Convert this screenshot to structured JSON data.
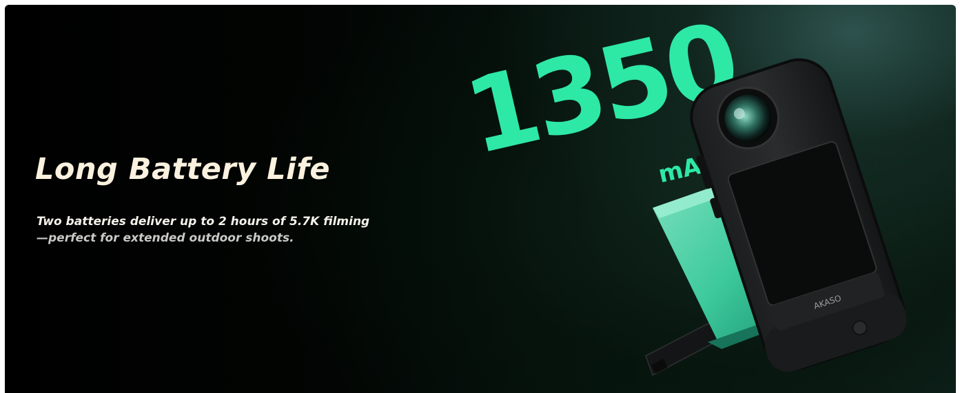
{
  "hero": {
    "title": "Long Battery Life",
    "description_line1": "Two batteries deliver up to 2 hours of 5.7K filming",
    "description_line2": "—perfect for extended outdoor shoots."
  },
  "battery_visual": {
    "capacity_value": "1350",
    "capacity_unit": "mAh",
    "brand_on_device": "AKASO"
  },
  "colors": {
    "accent": "#2ee8a6",
    "title_color": "#fbf1df",
    "background": "#000000"
  }
}
